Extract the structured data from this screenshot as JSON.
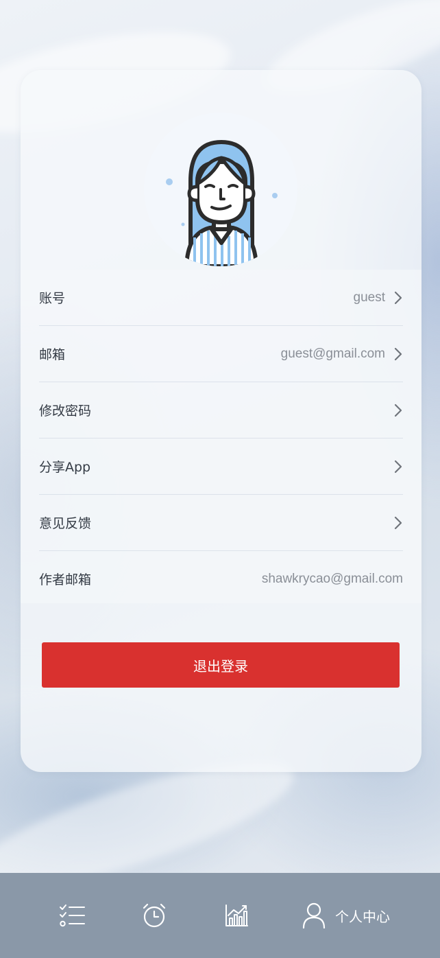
{
  "colors": {
    "accent_red": "#d9312f",
    "tabbar_bg": "#8a98a8",
    "label_text": "#333a44",
    "value_text": "#8a8f97"
  },
  "profile": {
    "avatar_icon": "female-user-avatar"
  },
  "rows": [
    {
      "label": "账号",
      "value": "guest",
      "has_chevron": true
    },
    {
      "label": "邮箱",
      "value": "guest@gmail.com",
      "has_chevron": true
    },
    {
      "label": "修改密码",
      "value": "",
      "has_chevron": true
    },
    {
      "label": "分享App",
      "value": "",
      "has_chevron": true
    },
    {
      "label": "意见反馈",
      "value": "",
      "has_chevron": true
    },
    {
      "label": "作者邮箱",
      "value": "shawkrycao@gmail.com",
      "has_chevron": false
    }
  ],
  "logout_label": "退出登录",
  "tabbar": {
    "tabs": [
      {
        "icon": "checklist-icon",
        "label": ""
      },
      {
        "icon": "alarm-clock-icon",
        "label": ""
      },
      {
        "icon": "chart-icon",
        "label": ""
      },
      {
        "icon": "user-icon",
        "label": "个人中心",
        "active": true
      }
    ]
  }
}
